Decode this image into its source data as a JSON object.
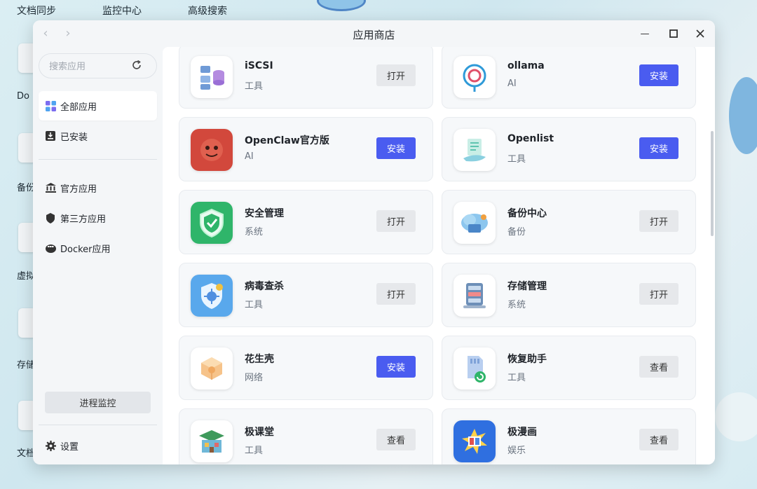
{
  "desktop": {
    "top_labels": [
      "文档同步",
      "监控中心",
      "高级搜索"
    ],
    "side_labels": [
      "Do",
      "备份",
      "虚拟",
      "存储",
      "文档"
    ]
  },
  "window": {
    "title": "应用商店",
    "back_symbol": "‹",
    "forward_symbol": "›",
    "min_symbol": "—",
    "max_symbol": "□",
    "close_symbol": "✕"
  },
  "sidebar": {
    "search_placeholder": "搜索应用",
    "items": [
      {
        "label": "全部应用",
        "icon": "grid-icon",
        "active": true
      },
      {
        "label": "已安装",
        "icon": "download-box-icon",
        "active": false
      },
      {
        "label": "官方应用",
        "icon": "bank-icon",
        "active": false
      },
      {
        "label": "第三方应用",
        "icon": "badge-icon",
        "active": false
      },
      {
        "label": "Docker应用",
        "icon": "docker-icon",
        "active": false
      }
    ],
    "process_monitor_label": "进程监控",
    "settings_label": "设置"
  },
  "apps": [
    {
      "name": "iSCSI",
      "category": "工具",
      "action": "打开",
      "type": "open",
      "icon": "iscsi-icon",
      "color": "#7aa7d8"
    },
    {
      "name": "ollama",
      "category": "AI",
      "action": "安装",
      "type": "install",
      "icon": "ollama-icon",
      "color": "#3aa6d8"
    },
    {
      "name": "OpenClaw官方版",
      "category": "AI",
      "action": "安装",
      "type": "install",
      "icon": "openclaw-icon",
      "color": "#d2483c"
    },
    {
      "name": "Openlist",
      "category": "工具",
      "action": "安装",
      "type": "install",
      "icon": "openlist-icon",
      "color": "#5fc4b0"
    },
    {
      "name": "安全管理",
      "category": "系统",
      "action": "打开",
      "type": "open",
      "icon": "shield-icon",
      "color": "#2fb56a"
    },
    {
      "name": "备份中心",
      "category": "备份",
      "action": "打开",
      "type": "open",
      "icon": "backup-cloud-icon",
      "color": "#5aa6e0"
    },
    {
      "name": "病毒查杀",
      "category": "工具",
      "action": "打开",
      "type": "open",
      "icon": "virus-shield-icon",
      "color": "#4a9fe8"
    },
    {
      "name": "存储管理",
      "category": "系统",
      "action": "打开",
      "type": "open",
      "icon": "storage-icon",
      "color": "#6d8fb8"
    },
    {
      "name": "花生壳",
      "category": "网络",
      "action": "安装",
      "type": "install",
      "icon": "peanut-icon",
      "color": "#f0b070"
    },
    {
      "name": "恢复助手",
      "category": "工具",
      "action": "查看",
      "type": "open",
      "icon": "sd-recover-icon",
      "color": "#2fb56a"
    },
    {
      "name": "极课堂",
      "category": "工具",
      "action": "查看",
      "type": "open",
      "icon": "classroom-icon",
      "color": "#3f9a5c"
    },
    {
      "name": "极漫画",
      "category": "娱乐",
      "action": "查看",
      "type": "open",
      "icon": "comic-icon",
      "color": "#2f6fe0"
    }
  ]
}
